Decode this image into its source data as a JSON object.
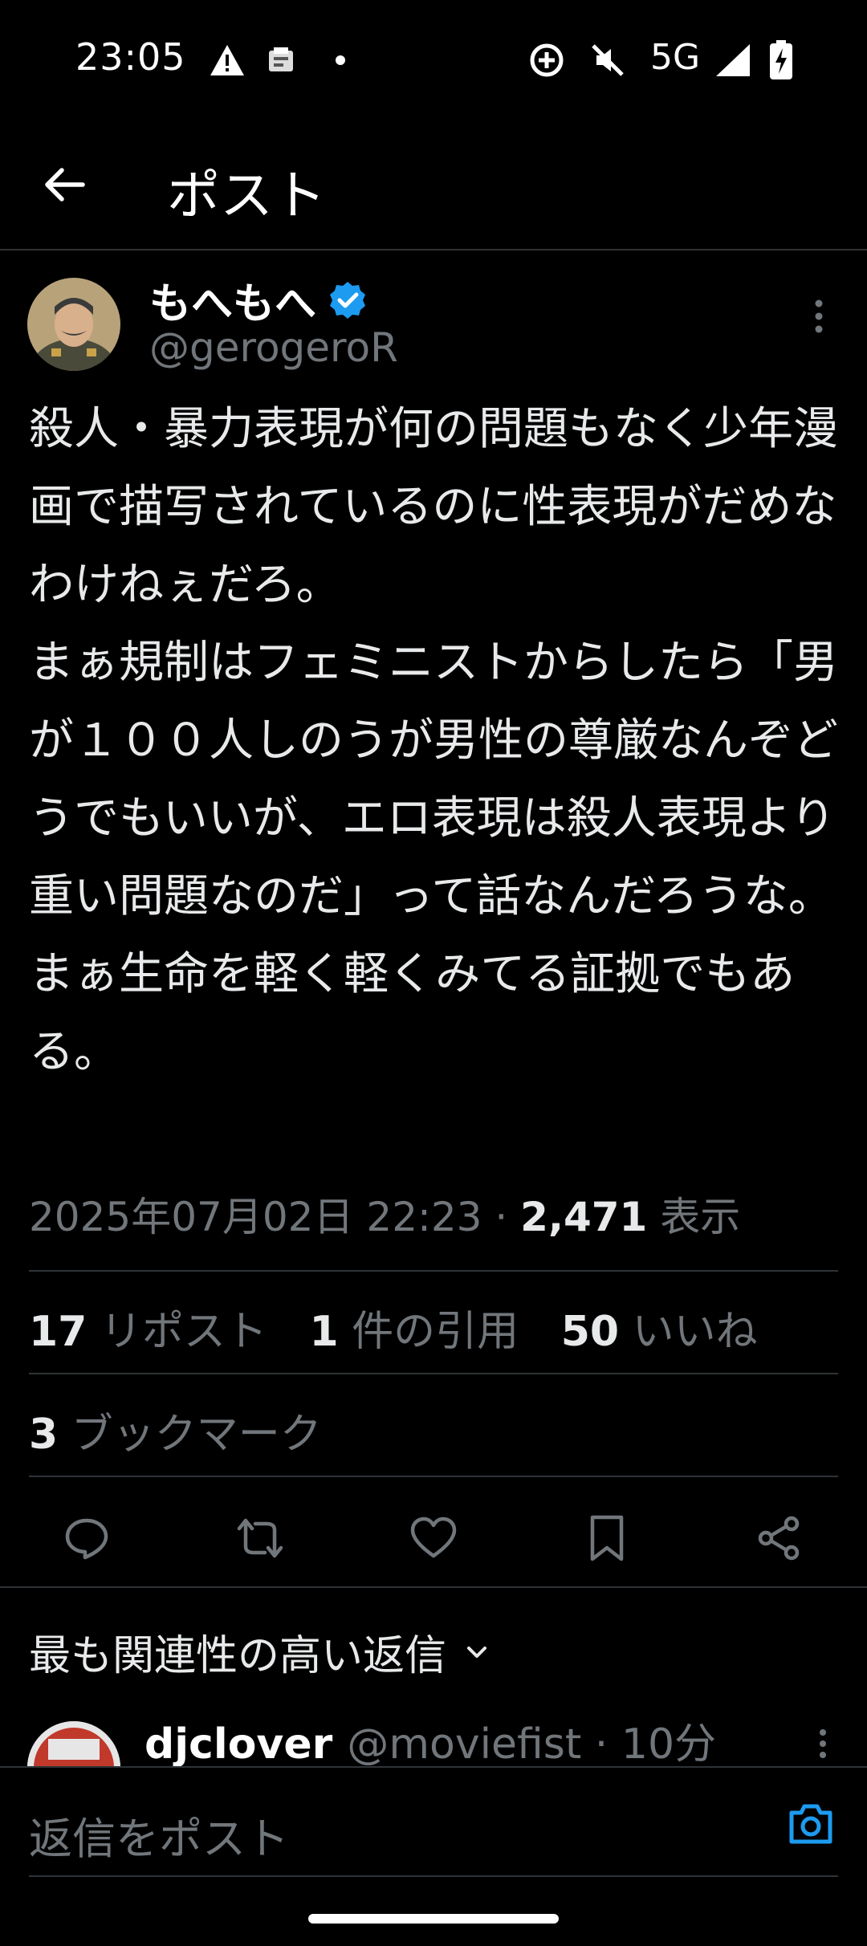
{
  "status_bar": {
    "time": "23:05",
    "network": "5G",
    "icons": [
      "warning-icon",
      "app-notification-icon",
      "dot-icon",
      "data-saver-icon",
      "mute-icon",
      "signal-icon",
      "battery-charging-icon"
    ]
  },
  "header": {
    "title": "ポスト"
  },
  "tweet": {
    "display_name": "もへもへ",
    "handle": "@gerogeroR",
    "verified": true,
    "body": "殺人・暴力表現が何の問題もなく少年漫画で描写されているのに性表現がだめなわけねぇだろ。\nまぁ規制はフェミニストからしたら「男が１００人しのうが男性の尊厳なんぞどうでもいいが、エロ表現は殺人表現より重い問題なのだ」って話なんだろうな。\nまぁ生命を軽く軽くみてる証拠でもある。",
    "timestamp": "2025年07月02日 22:23",
    "separator": " · ",
    "views_count": "2,471",
    "views_label": "表示"
  },
  "stats": {
    "reposts_count": "17",
    "reposts_label": "リポスト",
    "quotes_count": "1",
    "quotes_label": "件の引用",
    "likes_count": "50",
    "likes_label": "いいね",
    "bookmarks_count": "3",
    "bookmarks_label": "ブックマーク"
  },
  "replies": {
    "sort_label": "最も関連性の高い返信",
    "first_reply": {
      "name": "djclover",
      "handle": "@moviefist",
      "time": "10分"
    }
  },
  "composer": {
    "placeholder": "返信をポスト"
  },
  "colors": {
    "background": "#000000",
    "text": "#e7e9ea",
    "secondary": "#71767b",
    "accent": "#1d9bf0",
    "divider": "#2f3336"
  }
}
